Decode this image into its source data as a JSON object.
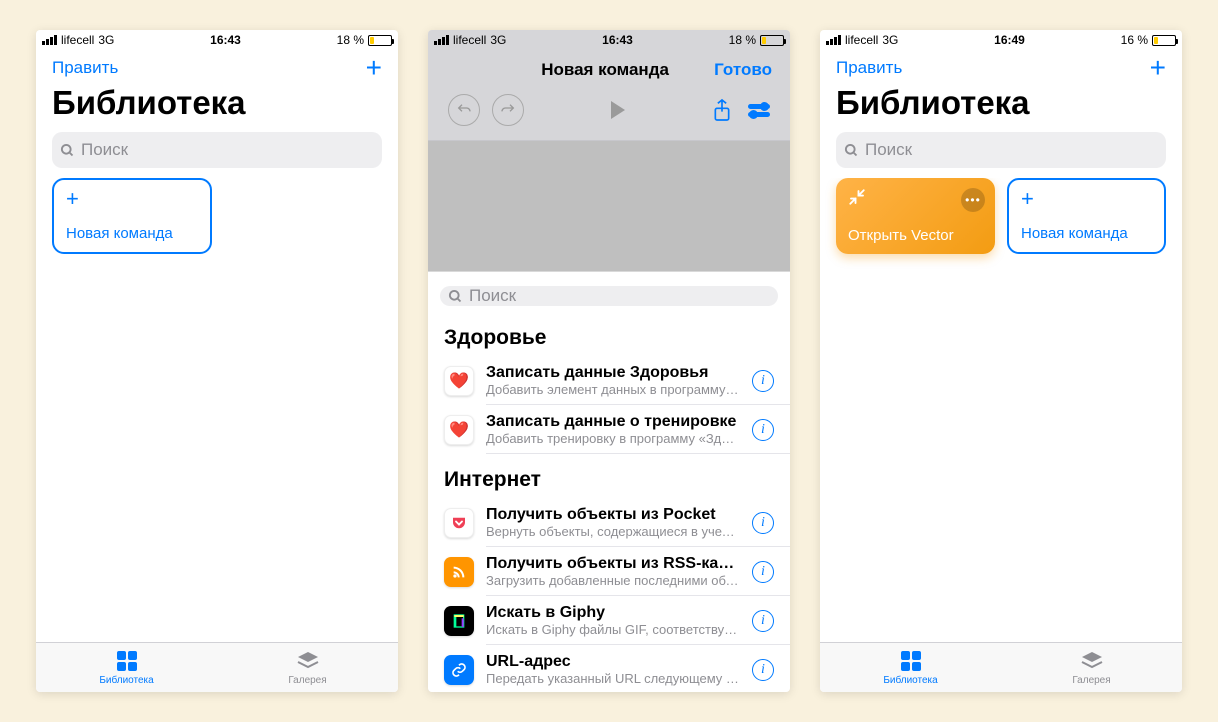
{
  "screen1": {
    "status": {
      "carrier": "lifecell",
      "network": "3G",
      "time": "16:43",
      "battery_pct": "18 %"
    },
    "nav_edit": "Править",
    "title": "Библиотека",
    "search_placeholder": "Поиск",
    "new_tile": "Новая команда",
    "tabs": {
      "library": "Библиотека",
      "gallery": "Галерея"
    }
  },
  "screen2": {
    "status": {
      "carrier": "lifecell",
      "network": "3G",
      "time": "16:43",
      "battery_pct": "18 %"
    },
    "nav_title": "Новая команда",
    "nav_done": "Готово",
    "search_placeholder": "Поиск",
    "sections": [
      {
        "header": "Здоровье",
        "items": [
          {
            "icon": "heart",
            "title": "Записать данные Здоровья",
            "sub": "Добавить элемент данных в программу «Здор…"
          },
          {
            "icon": "heart",
            "title": "Записать данные о тренировке",
            "sub": "Добавить тренировку в программу «Здоровье…"
          }
        ]
      },
      {
        "header": "Интернет",
        "items": [
          {
            "icon": "pocket",
            "title": "Получить объекты из Pocket",
            "sub": "Вернуть объекты, содержащиеся в учетной за…"
          },
          {
            "icon": "rss",
            "title": "Получить объекты из RSS-канала",
            "sub": "Загрузить добавленные последними объекты…"
          },
          {
            "icon": "giphy",
            "title": "Искать в Giphy",
            "sub": "Искать в Giphy файлы GIF, соответствующие ук…"
          },
          {
            "icon": "url",
            "title": "URL-адрес",
            "sub": "Передать указанный URL следующему дейст…"
          }
        ]
      }
    ]
  },
  "screen3": {
    "status": {
      "carrier": "lifecell",
      "network": "3G",
      "time": "16:49",
      "battery_pct": "16 %"
    },
    "nav_edit": "Править",
    "title": "Библиотека",
    "search_placeholder": "Поиск",
    "vector_tile": "Открыть Vector",
    "new_tile": "Новая команда",
    "tabs": {
      "library": "Библиотека",
      "gallery": "Галерея"
    }
  }
}
